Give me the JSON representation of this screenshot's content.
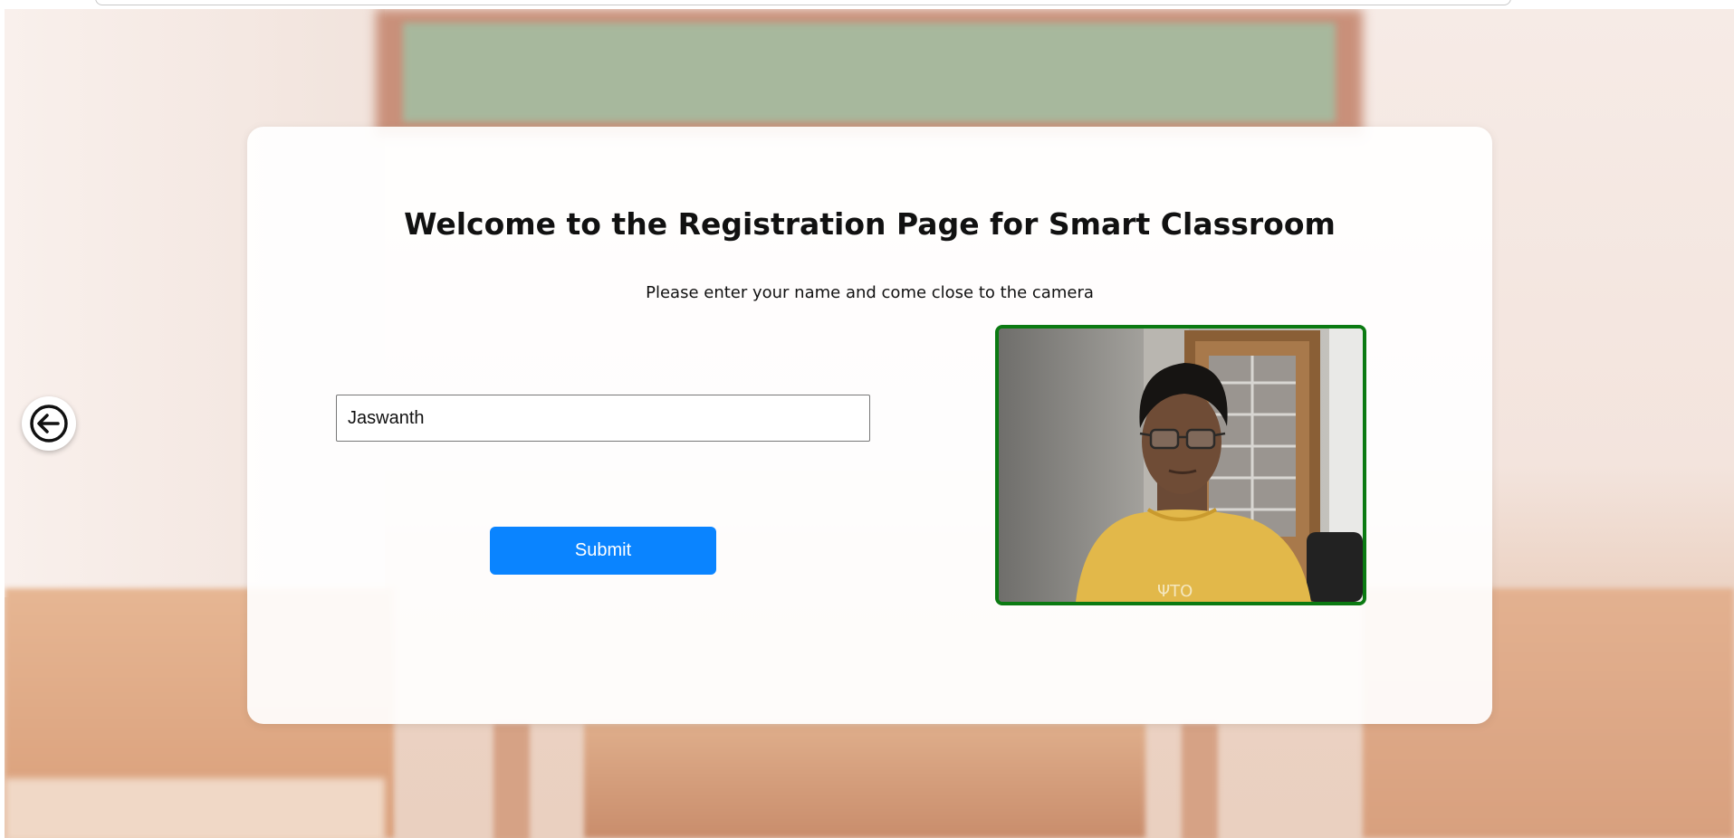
{
  "page": {
    "title": "Welcome to the Registration Page for Smart Classroom",
    "subtitle": "Please enter your name and come close to the camera"
  },
  "form": {
    "name_value": "Jaswanth",
    "submit_label": "Submit"
  },
  "nav": {
    "back_icon": "arrow-left-circle-icon"
  },
  "colors": {
    "submit": "#0a84ff",
    "camera_border": "#0b7a12",
    "card": "#ffffff"
  }
}
